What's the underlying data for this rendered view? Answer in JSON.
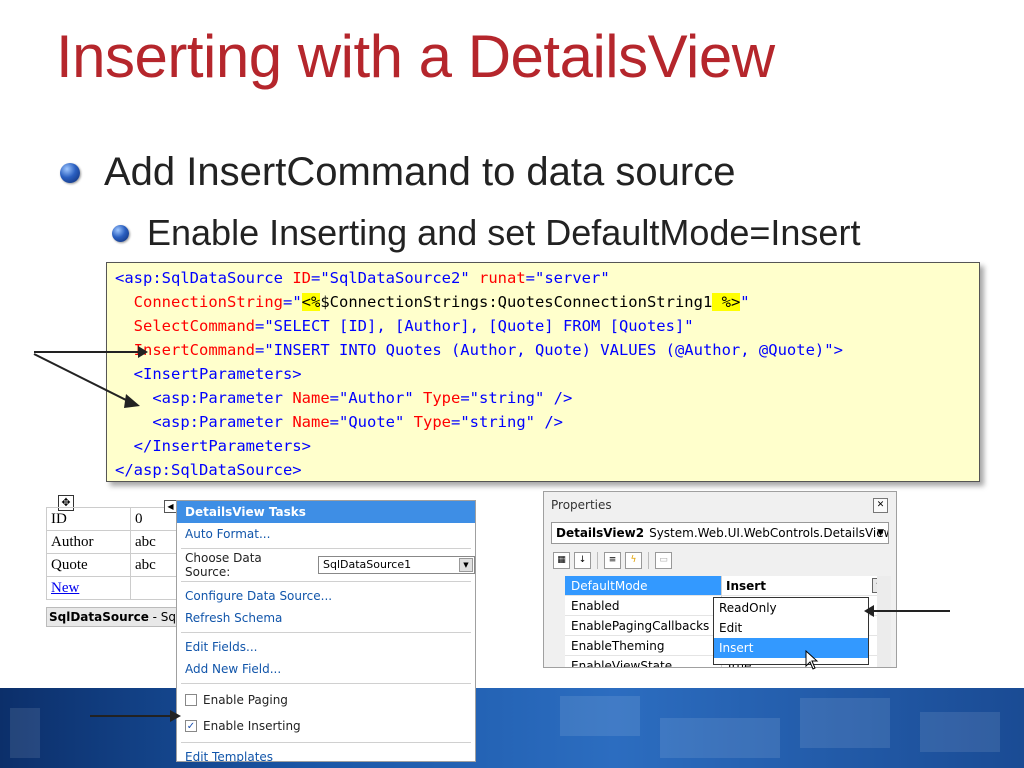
{
  "slide": {
    "title": "Inserting with a DetailsView",
    "bullet1": "Add InsertCommand to data source",
    "bullet2": "Enable Inserting and set DefaultMode=Insert"
  },
  "code": {
    "l1_open": "<asp:SqlDataSource",
    "l1_id_attr": "ID",
    "l1_id_val": "\"SqlDataSource2\"",
    "l1_runat_attr": "runat",
    "l1_runat_val": "\"server\"",
    "l2_attr": "ConnectionString",
    "l2_q1": "\"",
    "l2_hl1": "<%",
    "l2_mid": "$ConnectionStrings:QuotesConnectionString1",
    "l2_hl2": " %>",
    "l2_q2": "\"",
    "l3_attr": "SelectCommand",
    "l3_val": "\"SELECT [ID], [Author], [Quote] FROM [Quotes]\"",
    "l4_attr": "InsertCommand",
    "l4_val": "\"INSERT INTO Quotes (Author, Quote) VALUES (@Author, @Quote)\"",
    "l4_close": ">",
    "l5": "<InsertParameters>",
    "l6_open": "<asp:Parameter",
    "l6_name_attr": "Name",
    "l6_name_val": "\"Author\"",
    "l6_type_attr": "Type",
    "l6_type_val": "\"string\"",
    "l6_close": "/>",
    "l7_open": "<asp:Parameter",
    "l7_name_attr": "Name",
    "l7_name_val": "\"Quote\"",
    "l7_type_attr": "Type",
    "l7_type_val": "\"string\"",
    "l7_close": "/>",
    "l8": "</InsertParameters>",
    "l9": "</asp:SqlDataSource>"
  },
  "detailsview": {
    "rows": [
      {
        "field": "ID",
        "value": "0"
      },
      {
        "field": "Author",
        "value": "abc"
      },
      {
        "field": "Quote",
        "value": "abc"
      }
    ],
    "new_link": "New",
    "datasource_bar_bold": "SqlDataSource",
    "datasource_bar_rest": " - SqlD"
  },
  "tasks": {
    "header": "DetailsView Tasks",
    "auto_format": "Auto Format...",
    "choose_label": "Choose Data Source:",
    "choose_value": "SqlDataSource1",
    "configure": "Configure Data Source...",
    "refresh": "Refresh Schema",
    "edit_fields": "Edit Fields...",
    "add_field": "Add New Field...",
    "enable_paging": "Enable Paging",
    "enable_paging_checked": false,
    "enable_inserting": "Enable Inserting",
    "enable_inserting_checked": true,
    "edit_templates": "Edit Templates"
  },
  "properties": {
    "title": "Properties",
    "object_name": "DetailsView2",
    "object_type": "System.Web.UI.WebControls.DetailsView",
    "rows": [
      {
        "name": "DefaultMode",
        "value": "Insert",
        "selected": true
      },
      {
        "name": "Enabled",
        "value": ""
      },
      {
        "name": "EnablePagingCallbacks",
        "value": ""
      },
      {
        "name": "EnableTheming",
        "value": ""
      },
      {
        "name": "EnableViewState",
        "value": "True"
      }
    ],
    "dropdown_options": [
      "ReadOnly",
      "Edit",
      "Insert"
    ],
    "dropdown_selected": "Insert"
  },
  "colors": {
    "title": "#b5262c",
    "code_bg": "#ffffcc",
    "task_header": "#3e8ee5",
    "selection": "#3399ff"
  }
}
